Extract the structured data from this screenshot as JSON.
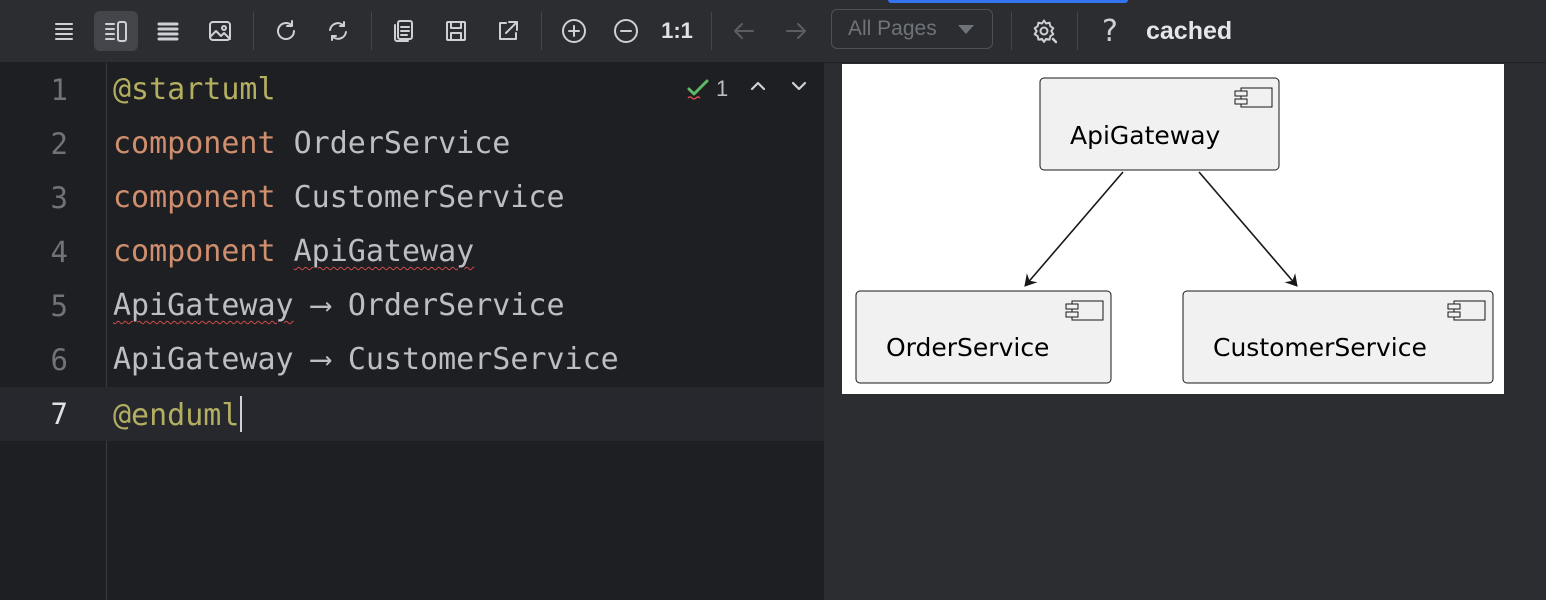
{
  "toolbar": {
    "zoom_actual_label": "1:1",
    "pages_select_value": "All Pages",
    "help_label": "?",
    "status_text": "cached"
  },
  "editor": {
    "lines": [
      {
        "num": "1",
        "t1": "@startuml"
      },
      {
        "num": "2",
        "t1": "component",
        "t2": "OrderService"
      },
      {
        "num": "3",
        "t1": "component",
        "t2": "CustomerService"
      },
      {
        "num": "4",
        "t1": "component",
        "t2": "ApiGateway"
      },
      {
        "num": "5",
        "t1": "ApiGateway",
        "t2": "⟶",
        "t3": "OrderService"
      },
      {
        "num": "6",
        "t1": "ApiGateway",
        "t2": "⟶",
        "t3": "CustomerService"
      },
      {
        "num": "7",
        "t1": "@enduml"
      }
    ],
    "inspection_count": "1"
  },
  "diagram": {
    "components": [
      "ApiGateway",
      "OrderService",
      "CustomerService"
    ]
  },
  "colors": {
    "accent": "#3574f0",
    "keyword": "#cf8e6d",
    "annotation": "#b3ae60",
    "check_ok": "#5fb865",
    "error_squiggle": "#d14b4b"
  }
}
